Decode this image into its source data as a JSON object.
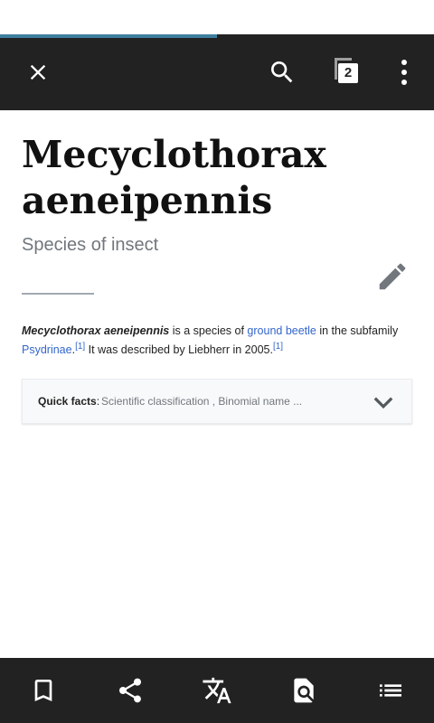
{
  "toolbar": {
    "progress_fraction": 0.5,
    "tabs_count": "2",
    "icons": [
      "close-icon",
      "search-icon",
      "tabs-icon",
      "overflow-menu-icon"
    ]
  },
  "article": {
    "title": "Mecyclothorax aeneipennis",
    "description": "Species of insect",
    "intro": {
      "bold_name": "Mecyclothorax aeneipennis",
      "text_1": " is a species of ",
      "link_ground_beetle": "ground beetle",
      "text_2": " in the subfamily ",
      "link_psydrinae": "Psydrinae",
      "text_3": ".",
      "ref_1": "[1]",
      "text_4": " It was described by Liebherr in 2005.",
      "ref_2": "[1]"
    },
    "quick_facts": {
      "label": "Quick facts",
      "colon": ":",
      "summary": " Scientific classification , Binomial name ..."
    }
  },
  "bottom_bar": {
    "icons": [
      "bookmark-icon",
      "share-icon",
      "translate-icon",
      "find-in-page-icon",
      "table-of-contents-icon"
    ]
  },
  "colors": {
    "toolbar_bg": "#222222",
    "progress": "#3f7f9f",
    "link": "#3366cc",
    "muted_text": "#72777d"
  }
}
